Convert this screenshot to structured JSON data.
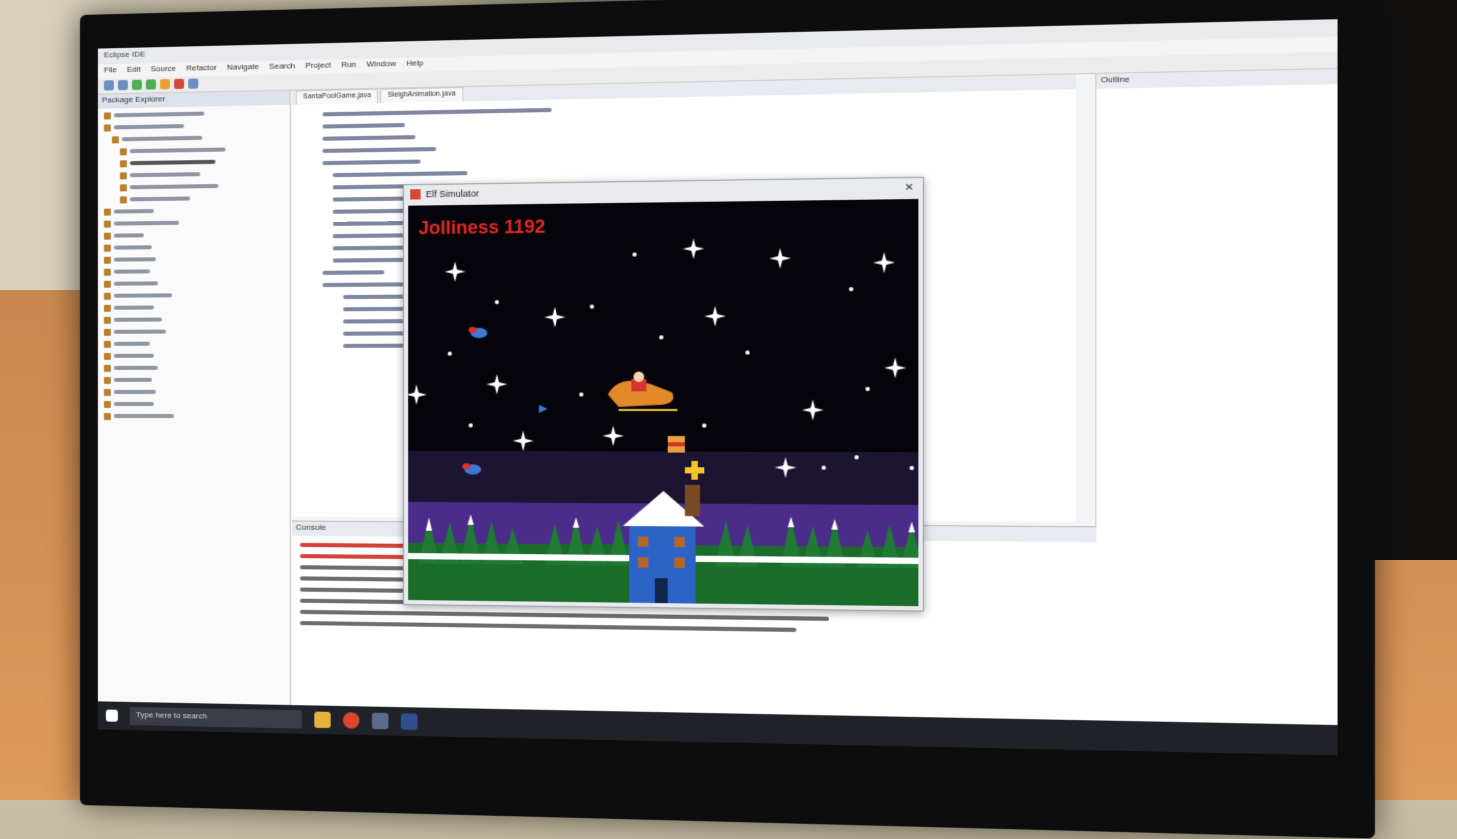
{
  "scene": {
    "game_window_title": "Elf Simulator",
    "score_label": "Jolliness",
    "score_value": "1192"
  },
  "ide": {
    "window_title": "Eclipse IDE",
    "menus": [
      "File",
      "Edit",
      "Source",
      "Refactor",
      "Navigate",
      "Search",
      "Project",
      "Run",
      "Window",
      "Help"
    ],
    "package_explorer": "Package Explorer",
    "editor_tabs": [
      "SantaPoolGame.java",
      "SleighAnimation.java"
    ],
    "outline": "Outline",
    "console": "Console",
    "taskbar_search": "Type here to search"
  },
  "colors": {
    "score_red": "#e02a24",
    "sky": "#05040a",
    "purple_hills": "#4b2c8a",
    "tree_green": "#1b6b2a",
    "house_blue": "#2b63c7"
  }
}
